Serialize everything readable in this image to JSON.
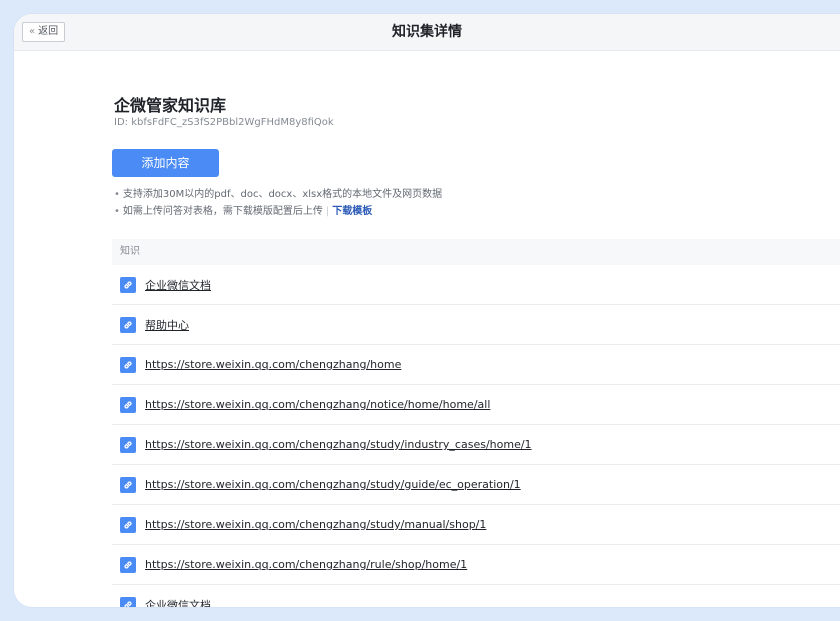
{
  "header": {
    "back_label": "返回",
    "title": "知识集详情"
  },
  "knowledge_base": {
    "name": "企微管家知识库",
    "id_text": "ID: kbfsFdFC_zS3fS2PBbl2WgFHdM8y8fiQok"
  },
  "add_button": {
    "label": "添加内容"
  },
  "tips": {
    "line1": "支持添加30M以内的pdf、doc、docx、xlsx格式的本地文件及网页数据",
    "line2": "如需上传问答对表格，需下载模版配置后上传",
    "download_link": "下载模板"
  },
  "table": {
    "header": "知识",
    "rows": [
      "企业微信文档",
      "帮助中心",
      "https://store.weixin.qq.com/chengzhang/home",
      "https://store.weixin.qq.com/chengzhang/notice/home/home/all",
      "https://store.weixin.qq.com/chengzhang/study/industry_cases/home/1",
      "https://store.weixin.qq.com/chengzhang/study/guide/ec_operation/1",
      "https://store.weixin.qq.com/chengzhang/study/manual/shop/1",
      "https://store.weixin.qq.com/chengzhang/rule/shop/home/1",
      "企业微信文档"
    ]
  },
  "icons": {
    "back": "double-chevron-left-icon",
    "link": "link-icon"
  },
  "colors": {
    "accent": "#4a8bf5",
    "link": "#2c5bb7",
    "background": "#dbe9fb"
  }
}
